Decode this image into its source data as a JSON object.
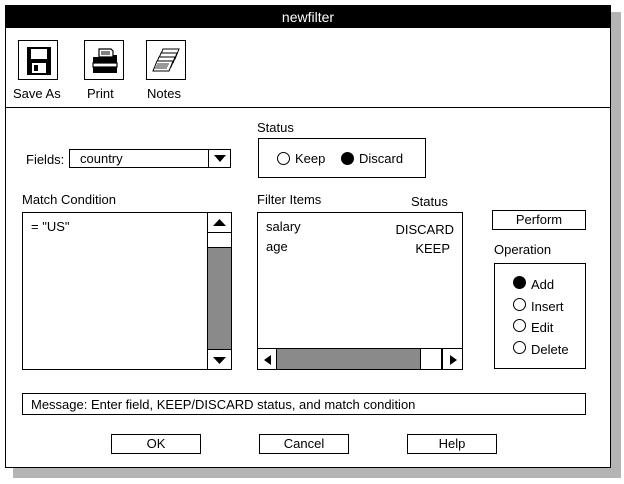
{
  "window": {
    "title": "newfilter"
  },
  "toolbar": {
    "items": [
      {
        "label": "Save As",
        "icon": "floppy-disk-icon"
      },
      {
        "label": "Print",
        "icon": "printer-icon"
      },
      {
        "label": "Notes",
        "icon": "notes-stack-icon"
      }
    ]
  },
  "fields": {
    "label": "Fields:",
    "value": "country"
  },
  "status_group": {
    "label": "Status",
    "options": [
      {
        "label": "Keep",
        "selected": false
      },
      {
        "label": "Discard",
        "selected": true
      }
    ]
  },
  "match_condition": {
    "label": "Match Condition",
    "value": "= \"US\""
  },
  "filter_items": {
    "label": "Filter Items",
    "status_header": "Status",
    "rows": [
      {
        "name": "salary",
        "status": "DISCARD"
      },
      {
        "name": "age",
        "status": "KEEP"
      }
    ]
  },
  "perform": {
    "label": "Perform"
  },
  "operation": {
    "label": "Operation",
    "options": [
      {
        "label": "Add",
        "selected": true
      },
      {
        "label": "Insert",
        "selected": false
      },
      {
        "label": "Edit",
        "selected": false
      },
      {
        "label": "Delete",
        "selected": false
      }
    ]
  },
  "message": {
    "text": "Message: Enter field, KEEP/DISCARD status, and match condition"
  },
  "buttons": {
    "ok": "OK",
    "cancel": "Cancel",
    "help": "Help"
  }
}
